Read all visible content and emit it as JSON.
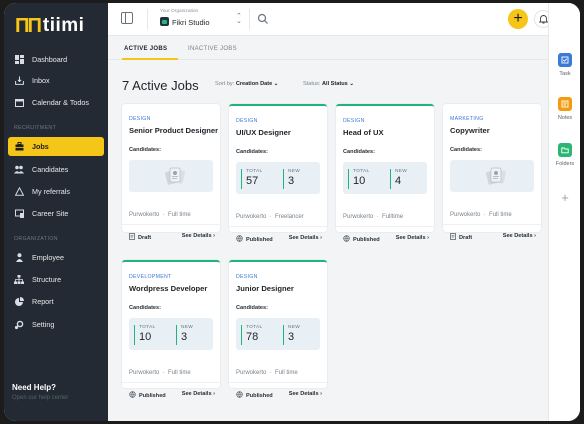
{
  "app": {
    "logo_text": "tiimi"
  },
  "sidebar": {
    "main_items": [
      {
        "label": "Dashboard",
        "icon": "dashboard-icon"
      },
      {
        "label": "Inbox",
        "icon": "inbox-icon"
      },
      {
        "label": "Calendar & Todos",
        "icon": "calendar-icon"
      }
    ],
    "recruitment_label": "RECRUITMENT",
    "recruitment_items": [
      {
        "label": "Jobs",
        "icon": "briefcase-icon",
        "active": true
      },
      {
        "label": "Candidates",
        "icon": "people-icon"
      },
      {
        "label": "My referrals",
        "icon": "triangle-icon"
      },
      {
        "label": "Career Site",
        "icon": "window-icon"
      }
    ],
    "organization_label": "ORGANIZATION",
    "organization_items": [
      {
        "label": "Employee",
        "icon": "person-icon"
      },
      {
        "label": "Structure",
        "icon": "sitemap-icon"
      },
      {
        "label": "Report",
        "icon": "pie-chart-icon"
      },
      {
        "label": "Setting",
        "icon": "gear-icon"
      }
    ],
    "help_title": "Need Help?",
    "help_subtitle": "Open our help center"
  },
  "topbar": {
    "org_caption": "Your Organization",
    "org_name": "Fikri Studio",
    "plus_label": "+"
  },
  "right_panel": {
    "items": [
      {
        "label": "Task",
        "icon": "task-icon",
        "color": "#3a7bd5"
      },
      {
        "label": "Notes",
        "icon": "notes-icon",
        "color": "#f39c12"
      },
      {
        "label": "Folders",
        "icon": "folder-icon",
        "color": "#2bb673"
      }
    ],
    "add_label": "+"
  },
  "tabs": [
    {
      "label": "ACTIVE JOBS",
      "active": true
    },
    {
      "label": "INACTIVE JOBS",
      "active": false
    }
  ],
  "main": {
    "heading": "7 Active Jobs",
    "sort_label": "Sort by:",
    "sort_value": "Creation Date",
    "status_label": "Status:",
    "status_value": "All Status"
  },
  "jobs": [
    {
      "dept": "DESIGN",
      "title": "Senior Product Designer",
      "candidates_label": "Candidates:",
      "empty": true,
      "location": "Purwokerto",
      "type": "Full time",
      "status": "Draft",
      "details": "See Details"
    },
    {
      "dept": "DESIGN",
      "title": "UI/UX Designer",
      "candidates_label": "Candidates:",
      "empty": false,
      "total_label": "TOTAL",
      "total": "57",
      "new_label": "NEW",
      "new": "3",
      "location": "Purwokerto",
      "type": "Freelancer",
      "status": "Published",
      "details": "See Details"
    },
    {
      "dept": "DESIGN",
      "title": "Head of UX",
      "candidates_label": "Candidates:",
      "empty": false,
      "total_label": "TOTAL",
      "total": "10",
      "new_label": "NEW",
      "new": "4",
      "location": "Purwokerto",
      "type": "Fulltime",
      "status": "Published",
      "details": "See Details"
    },
    {
      "dept": "MARKETING",
      "title": "Copywriter",
      "candidates_label": "Candidates:",
      "empty": true,
      "location": "Purwokerto",
      "type": "Full time",
      "status": "Draft",
      "details": "See Details"
    },
    {
      "dept": "DEVELOPMENT",
      "title": "Wordpress Developer",
      "candidates_label": "Candidates:",
      "empty": false,
      "total_label": "TOTAL",
      "total": "10",
      "new_label": "NEW",
      "new": "3",
      "location": "Purwokerto",
      "type": "Full time",
      "status": "Published",
      "details": "See Details"
    },
    {
      "dept": "DESIGN",
      "title": "Junior Designer",
      "candidates_label": "Candidates:",
      "empty": false,
      "total_label": "TOTAL",
      "total": "78",
      "new_label": "NEW",
      "new": "3",
      "location": "Purwokerto",
      "type": "Full time",
      "status": "Published",
      "details": "See Details"
    }
  ],
  "colors": {
    "accent": "#f5c518",
    "sidebar_bg": "#232a33",
    "published": "#1fb57a",
    "dept": "#3a7bd5"
  }
}
